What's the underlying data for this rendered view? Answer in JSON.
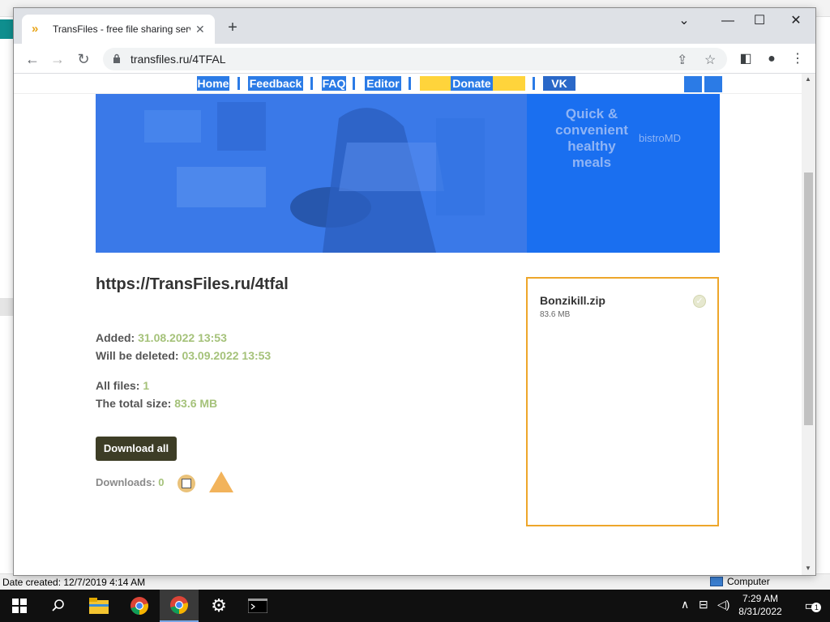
{
  "explorer": {
    "status_left": "Date created: 12/7/2019 4:14 AM",
    "status_right": "Computer"
  },
  "browser": {
    "tab_title": "TransFiles - free file sharing service",
    "url": "transfiles.ru/4TFAL"
  },
  "site": {
    "nav": [
      "Home",
      "Feedback",
      "FAQ",
      "Editor",
      "Donate",
      "VK"
    ],
    "banner": {
      "tagline": "Quick &\nconvenient\nhealthy\nmeals",
      "brand": "bistroMD"
    },
    "file_link": "https://TransFiles.ru/4tfal",
    "added_label": "Added:",
    "added_value": "31.08.2022 13:53",
    "deleted_label": "Will be deleted:",
    "deleted_value": "03.09.2022 13:53",
    "all_files_label": "All files:",
    "all_files_value": "1",
    "total_size_label": "The total size:",
    "total_size_value": "83.6 MB",
    "download_all": "Download all",
    "downloads_label": "Downloads:",
    "downloads_value": "0",
    "files": [
      {
        "name": "Bonzikill.zip",
        "size": "83.6 MB"
      }
    ]
  },
  "taskbar": {
    "time": "7:29 AM",
    "date": "8/31/2022",
    "notification_count": "1"
  }
}
